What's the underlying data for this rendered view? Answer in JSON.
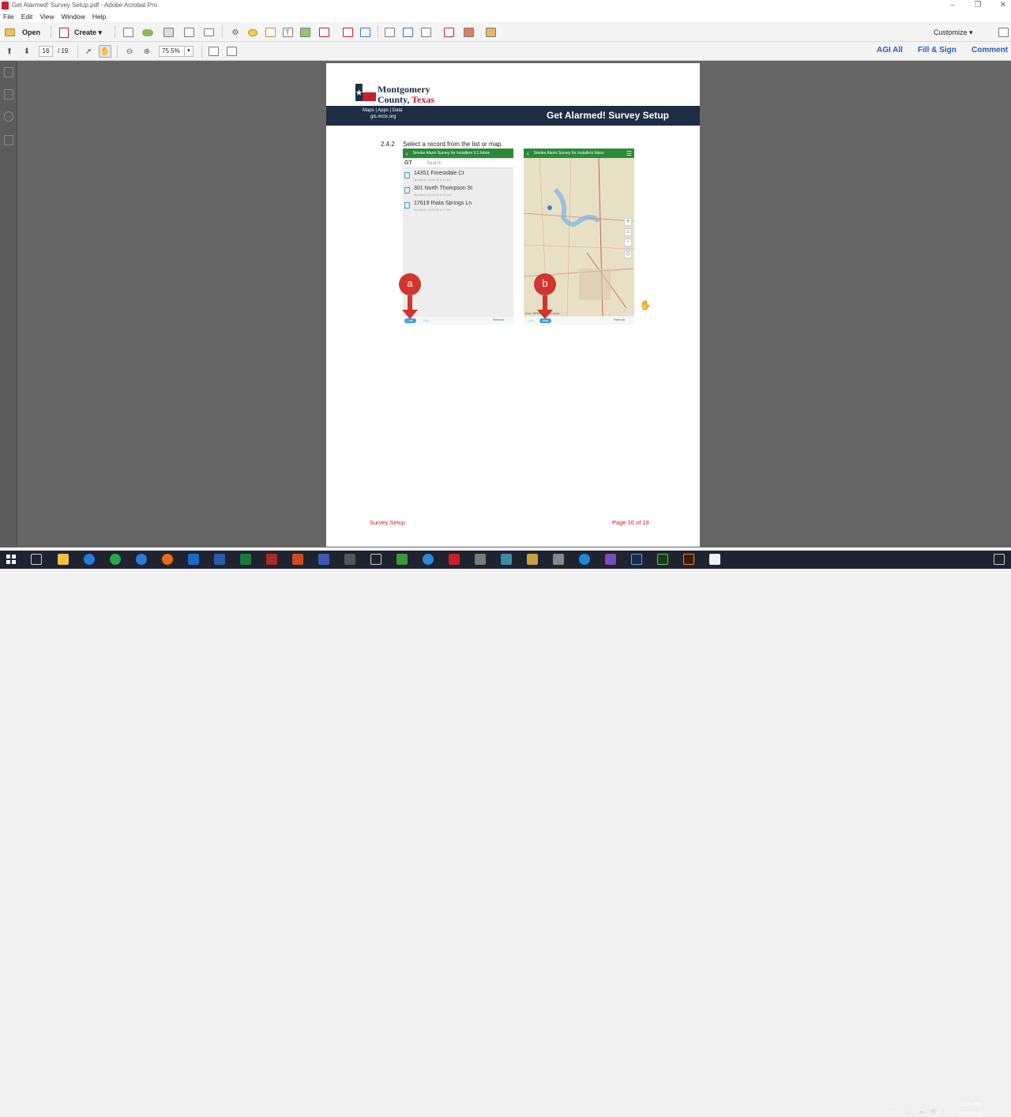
{
  "window": {
    "title": "Get Alarmed! Survey Setup.pdf - Adobe Acrobat Pro",
    "controls": [
      "–",
      "❐",
      "✕"
    ]
  },
  "menu": [
    "File",
    "Edit",
    "View",
    "Window",
    "Help"
  ],
  "toolbar": {
    "open_label": "Open",
    "create_label": "Create",
    "customize_label": "Customize"
  },
  "nav": {
    "current_page": "16",
    "total_pages": "/ 19",
    "zoom": "75.5%",
    "right_links": [
      "AGI All",
      "Fill & Sign",
      "Comment"
    ]
  },
  "document": {
    "logo_line1": "Montgomery",
    "logo_line2a": "County, ",
    "logo_line2b": "Texas",
    "banner_sub1": "Maps | Apps | Data",
    "banner_sub2": "gis.mctx.org",
    "banner_title": "Get Alarmed! Survey Setup",
    "step_number": "2.4.2",
    "step_text": "Select a record from the list or map.",
    "phone_list": {
      "header": "Smoke Alarm Survey for Installers V.1 Inbox",
      "search_prefix": "GT",
      "search_placeholder": "Search",
      "records": [
        {
          "title": "14351 Forestdale Ct",
          "sub": "Modified 10/06/18 8:13 AM"
        },
        {
          "title": "301 North Thompson St",
          "sub": "Modified 10/23/18 8:33 AM"
        },
        {
          "title": "17619 Riata Springs Ln",
          "sub": "Modified 10/23/18 8:17 AM"
        }
      ],
      "footer_list": "List",
      "footer_map": "Map",
      "footer_refresh": "Refresh"
    },
    "phone_map": {
      "header": "Smoke Alarm Survey for Installers Inbox",
      "zoom_in": "+",
      "zoom_out": "-",
      "attribution": "Esri, HERE, contributors",
      "footer_list": "List",
      "footer_map": "Map",
      "footer_refresh": "Refresh"
    },
    "callout_a": "a",
    "callout_b": "b",
    "footer_left": "Survey Setup",
    "footer_right": "Page 16 of 19"
  },
  "taskbar": {
    "time": "1:08 PM",
    "date": "11/7/2018"
  }
}
